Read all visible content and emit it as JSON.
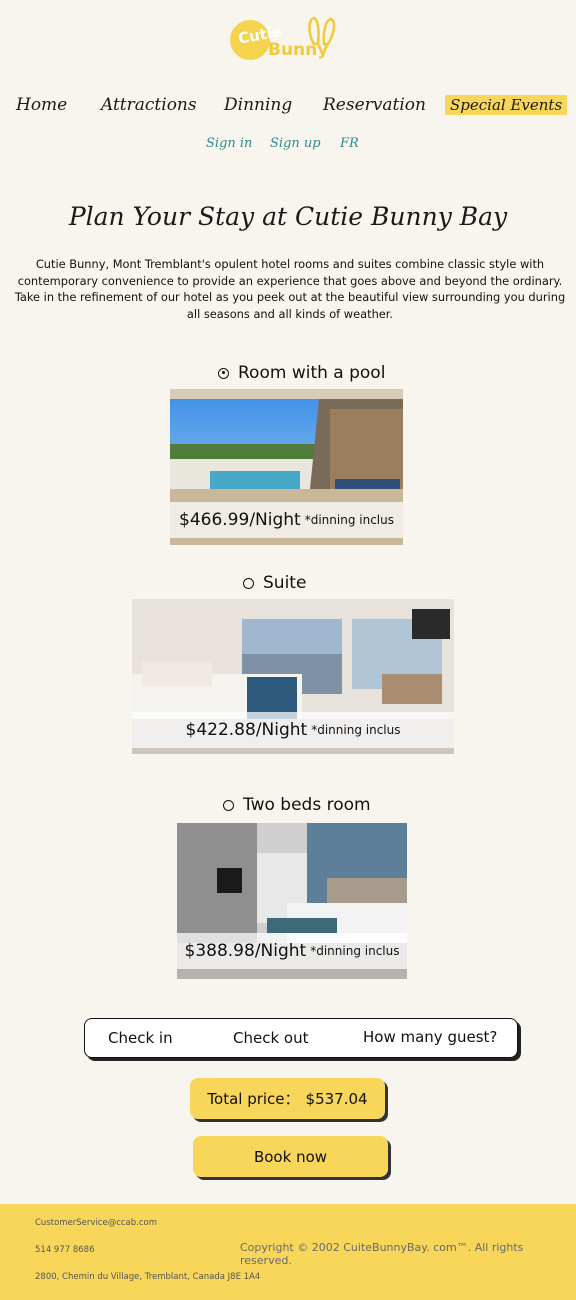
{
  "logo": {
    "line1": "Cutie",
    "line2": "Bunny"
  },
  "nav": {
    "home": "Home",
    "attractions": "Attractions",
    "dinning": "Dinning",
    "reservation": "Reservation",
    "special_events": "Special Events"
  },
  "auth": {
    "sign_in": "Sign in",
    "sign_up": "Sign up",
    "lang": "FR"
  },
  "main": {
    "title": "Plan Your Stay at Cutie Bunny Bay",
    "intro": "Cutie Bunny, Mont Tremblant's opulent hotel rooms and suites combine classic style with contemporary convenience  to provide an experience that goes above and beyond the ordinary. Take in the refinement of our hotel as you peek  out at the beautiful view surrounding you during all seasons and all kinds of weather."
  },
  "rooms": [
    {
      "name": "Room with a pool",
      "price": "$466.99/Night",
      "note": "*dinning inclus",
      "selected": true
    },
    {
      "name": "Suite",
      "price": "$422.88/Night",
      "note": "*dinning inclus",
      "selected": false
    },
    {
      "name": "Two beds room",
      "price": "$388.98/Night",
      "note": "*dinning inclus",
      "selected": false
    }
  ],
  "booking": {
    "check_in": "Check in",
    "check_out": "Check out",
    "guests": "How many guest?"
  },
  "total": {
    "label": "Total price：",
    "value": "$537.04"
  },
  "book_now": "Book now",
  "footer": {
    "email": "CustomerService@ccab.com",
    "phone": "514 977 8686",
    "address": "2800, Chemin du Village, Tremblant, Canada J8E 1A4",
    "copyright": "Copyright © 2002 CuiteBunnyBay. com™. All rights reserved."
  },
  "colors": {
    "accent": "#f7d65a",
    "link": "#2f8c8c",
    "background": "#f8f5ee"
  }
}
